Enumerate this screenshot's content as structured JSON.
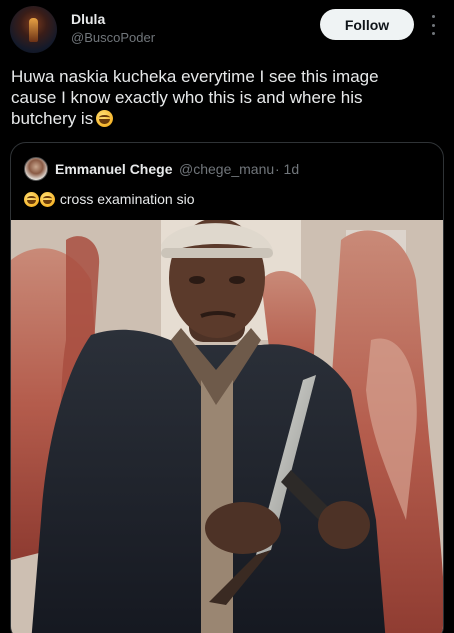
{
  "author": {
    "display_name": "Dlula",
    "handle": "@BuscoPoder"
  },
  "actions": {
    "follow_label": "Follow",
    "more_icon": "more-vertical-icon"
  },
  "post": {
    "lines": [
      "Huwa naskia kucheka everytime I see this image",
      "cause I know exactly who this is and where his",
      "butchery is"
    ],
    "emoji": "grinning-sweat-emoji"
  },
  "quoted": {
    "display_name": "Emmanuel Chege",
    "handle": "@chege_manu",
    "time": "· 1d",
    "text": "cross examination sio",
    "emoji_prefix": [
      "grinning-emoji",
      "grinning-emoji"
    ]
  },
  "colors": {
    "background": "#000000",
    "text_primary": "#e7e9ea",
    "text_secondary": "#71767b",
    "border": "#2f3336",
    "follow_bg": "#eff3f4"
  }
}
